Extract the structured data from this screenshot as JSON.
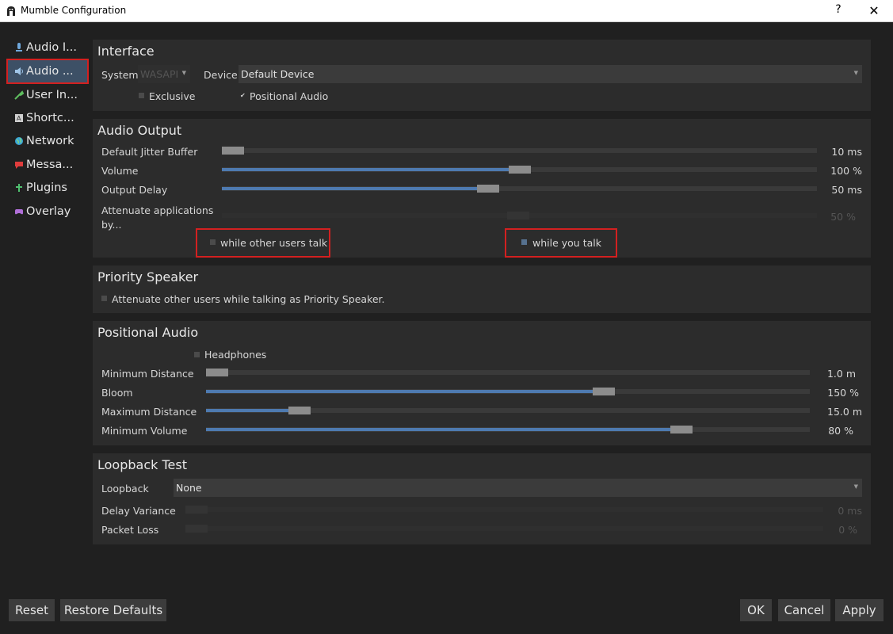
{
  "window": {
    "title": "Mumble Configuration",
    "help_glyph": "?",
    "close_glyph": "✕"
  },
  "sidebar": {
    "items": [
      {
        "label": "Audio I...",
        "icon": "microphone-icon"
      },
      {
        "label": "Audio ...",
        "icon": "speaker-icon"
      },
      {
        "label": "User In...",
        "icon": "wrench-icon"
      },
      {
        "label": "Shortc...",
        "icon": "keyboard-icon"
      },
      {
        "label": "Network",
        "icon": "globe-icon"
      },
      {
        "label": "Messa...",
        "icon": "message-icon"
      },
      {
        "label": "Plugins",
        "icon": "puzzle-icon"
      },
      {
        "label": "Overlay",
        "icon": "gamepad-icon"
      }
    ],
    "selected_index": 1
  },
  "interface": {
    "title": "Interface",
    "system_label": "System",
    "system_value": "WASAPI",
    "device_label": "Device",
    "device_value": "Default Device",
    "exclusive_label": "Exclusive",
    "exclusive_checked": false,
    "positional_label": "Positional Audio",
    "positional_checked": true
  },
  "audio_output": {
    "title": "Audio Output",
    "jitter_label": "Default Jitter Buffer",
    "jitter_value": "10 ms",
    "jitter_level": 0.0,
    "volume_label": "Volume",
    "volume_value": "100 %",
    "volume_level": 0.5,
    "delay_label": "Output Delay",
    "delay_value": "50 ms",
    "delay_level": 0.45,
    "attenuate_label": "Attenuate applications by...",
    "attenuate_value": "50 %",
    "attenuate_level": 0.5,
    "while_others_label": "while other users talk",
    "while_you_label": "while you talk"
  },
  "priority_speaker": {
    "title": "Priority Speaker",
    "attenuate_label": "Attenuate other users while talking as Priority Speaker."
  },
  "positional_audio": {
    "title": "Positional Audio",
    "headphones_label": "Headphones",
    "min_distance_label": "Minimum Distance",
    "min_distance_value": "1.0 m",
    "min_distance_level": 0.0,
    "bloom_label": "Bloom",
    "bloom_value": "150 %",
    "bloom_level": 0.66,
    "max_distance_label": "Maximum Distance",
    "max_distance_value": "15.0 m",
    "max_distance_level": 0.14,
    "min_volume_label": "Minimum Volume",
    "min_volume_value": "80 %",
    "min_volume_level": 0.8
  },
  "loopback": {
    "title": "Loopback Test",
    "loopback_label": "Loopback",
    "loopback_value": "None",
    "delay_variance_label": "Delay Variance",
    "delay_variance_value": "0 ms",
    "packet_loss_label": "Packet Loss",
    "packet_loss_value": "0 %"
  },
  "buttons": {
    "reset": "Reset",
    "restore_defaults": "Restore Defaults",
    "ok": "OK",
    "cancel": "Cancel",
    "apply": "Apply"
  },
  "colors": {
    "accent": "#4e7ab0",
    "selection": "#3d5066",
    "highlight_box": "#d32020"
  }
}
